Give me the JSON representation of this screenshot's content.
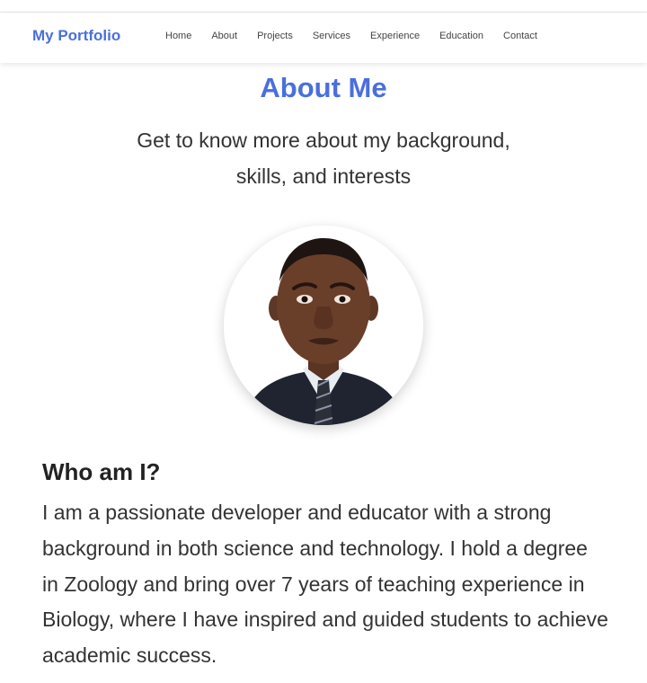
{
  "brand": {
    "name": "My Portfolio",
    "color": "#4a6fdc"
  },
  "nav": {
    "items": [
      {
        "label": "Home"
      },
      {
        "label": "About"
      },
      {
        "label": "Projects"
      },
      {
        "label": "Services"
      },
      {
        "label": "Experience"
      },
      {
        "label": "Education"
      },
      {
        "label": "Contact"
      }
    ]
  },
  "about": {
    "title": "About Me",
    "subtitle": "Get to know more about my background, skills, and interests",
    "avatar_icon": "profile-photo",
    "who_heading": "Who am I?",
    "bio": "I am a passionate developer and educator with a strong background in both science and technology. I hold a degree in Zoology and bring over 7 years of teaching experience in Biology, where I have inspired and guided students to achieve academic success."
  },
  "colors": {
    "accent": "#4a6fdc",
    "text": "#333333",
    "background": "#ffffff"
  }
}
